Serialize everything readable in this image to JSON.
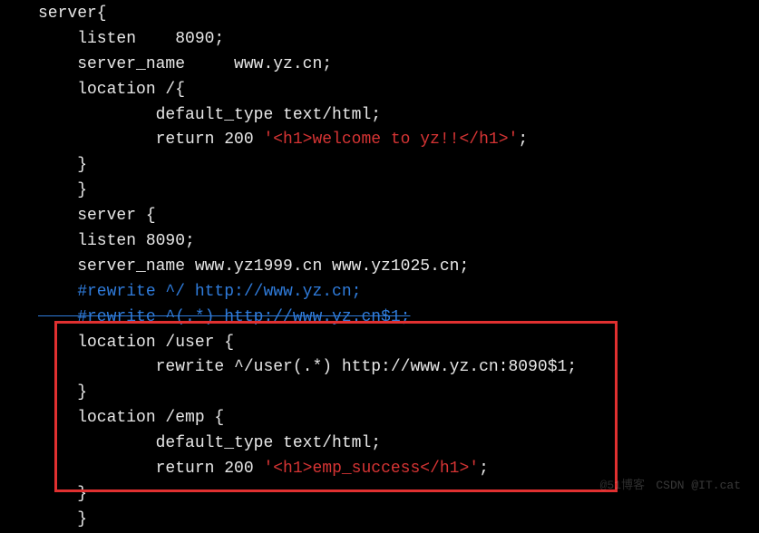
{
  "code": {
    "l1": "server{",
    "l2": "    listen    8090;",
    "l3": "    server_name     www.yz.cn;",
    "l4": "    location /{",
    "l5a": "            default_type text/html;",
    "l5b": "            return 200 ",
    "l5c": "'<h1>welcome to yz!!</h1>'",
    "l5d": ";",
    "l6": "    }",
    "l7": "    }",
    "l8": "    server {",
    "l9": "    listen 8090;",
    "l10": "    server_name www.yz1999.cn www.yz1025.cn;",
    "l11": "    #rewrite ^/ http://www.yz.cn;",
    "l12": "    #rewrite ^(.*) http://www.yz.cn$1;",
    "l13": "    location /user {",
    "l14": "            rewrite ^/user(.*) http://www.yz.cn:8090$1;",
    "l15": "    }",
    "l16": "    location /emp {",
    "l17": "            default_type text/html;",
    "l18a": "            return 200 ",
    "l18b": "'<h1>emp_success</h1>'",
    "l18c": ";",
    "l19": "    }",
    "l20": "    }"
  },
  "watermark": "CSDN @IT.cat",
  "watermark2": "@51博客"
}
